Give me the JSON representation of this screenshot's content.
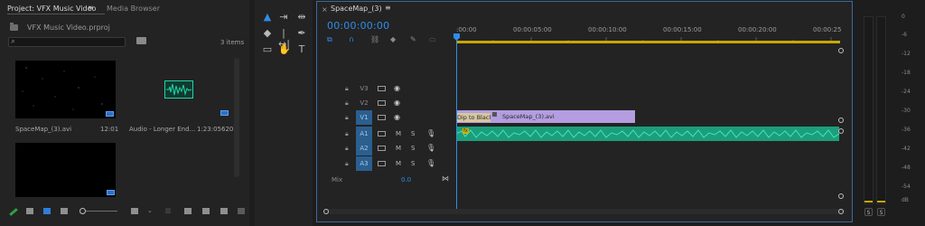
{
  "project_panel": {
    "tab_active": "Project: VFX Music Video",
    "tab_menu": "≡",
    "tab_other": "Media Browser",
    "project_file": "VFX Music Video.prproj",
    "search_placeholder": "",
    "items_count": "3 items",
    "clips": [
      {
        "name": "SpaceMap_(3).avi",
        "duration": "12:01"
      },
      {
        "name": "Audio - Longer End...",
        "duration": "1:23:05620"
      }
    ]
  },
  "tools": {
    "select": "▲",
    "track_select": "⇥",
    "ripple": "⇹",
    "razor": "◆",
    "slip": "|↔|",
    "pen": "✒",
    "rect": "▭",
    "hand": "✋",
    "type": "T"
  },
  "timeline": {
    "sequence_tab": "SpaceMap_(3)",
    "close": "×",
    "menu": "≡",
    "timecode": "00:00:00:00",
    "ruler": [
      ":00:00",
      "00:00:05:00",
      "00:00:10:00",
      "00:00:15:00",
      "00:00:20:00",
      "00:00:25"
    ],
    "tracks": [
      {
        "name": "V3",
        "targeted": false,
        "kind": "video"
      },
      {
        "name": "V2",
        "targeted": false,
        "kind": "video"
      },
      {
        "name": "V1",
        "targeted": true,
        "kind": "video"
      },
      {
        "name": "A1",
        "targeted": true,
        "kind": "audio"
      },
      {
        "name": "A2",
        "targeted": true,
        "kind": "audio"
      },
      {
        "name": "A3",
        "targeted": true,
        "kind": "audio"
      }
    ],
    "mute_label": "M",
    "solo_label": "S",
    "mix_label": "Mix",
    "mix_value": "0.0",
    "v1_clip": {
      "transition": "Dip to Black",
      "name": "SpaceMap_(3).avi"
    },
    "a1_fx": "fx"
  },
  "meters": {
    "db_labels": [
      "0",
      "-6",
      "-12",
      "-18",
      "-24",
      "-30",
      "-36",
      "-42",
      "-48",
      "-54",
      "dB"
    ],
    "solo": "S"
  },
  "colors": {
    "accent_blue": "#2f8ce8",
    "video_clip": "#b49de0",
    "audio_clip": "#1c9e7c",
    "work_area": "#c9a800"
  }
}
